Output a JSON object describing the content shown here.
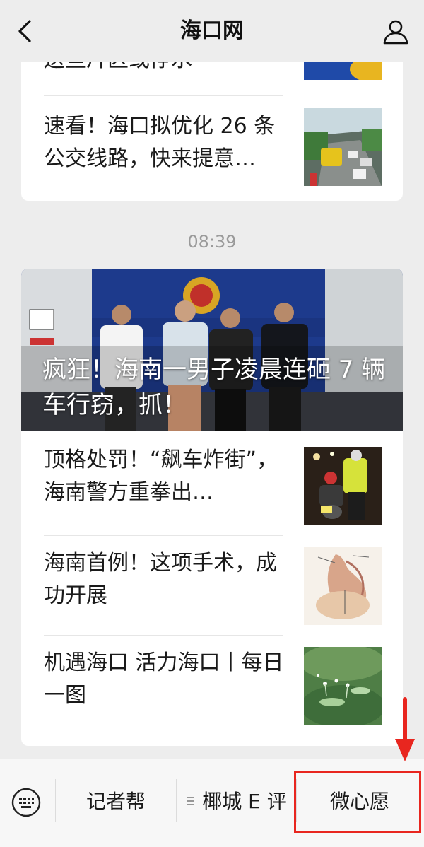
{
  "header": {
    "title": "海口网"
  },
  "card1": {
    "partial_title": "送些片区或停水",
    "items": [
      {
        "title": "速看！海口拟优化 26 条公交线路，快来提意…"
      }
    ]
  },
  "timestamp": "08:39",
  "card2": {
    "hero_title": "疯狂！海南一男子凌晨连砸 7 辆车行窃，抓！",
    "items": [
      {
        "title": "顶格处罚！“飙车炸街”，海南警方重拳出…"
      },
      {
        "title": "海南首例！这项手术，成功开展"
      },
      {
        "title": "机遇海口 活力海口丨每日一图"
      }
    ]
  },
  "bottom_menu": {
    "items": [
      {
        "label": "记者帮"
      },
      {
        "label": "椰城 E 评"
      },
      {
        "label": "微心愿"
      }
    ]
  },
  "colors": {
    "highlight": "#e8261f",
    "background": "#ededed"
  }
}
